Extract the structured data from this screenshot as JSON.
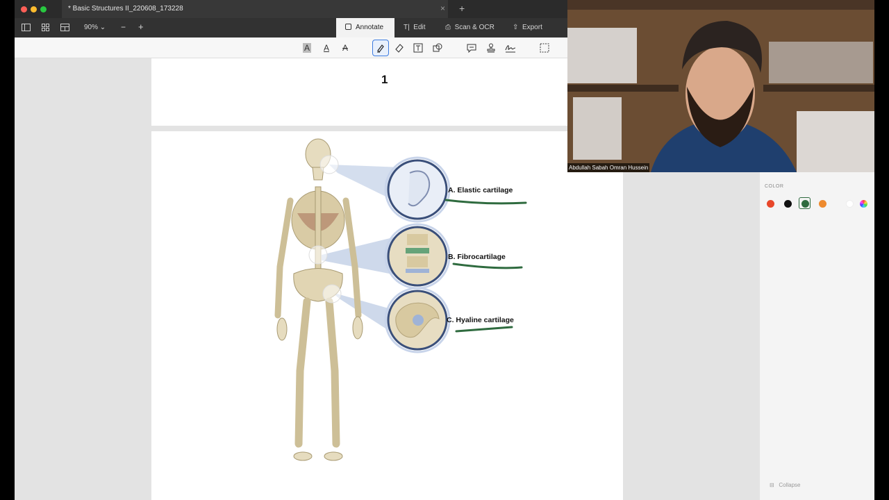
{
  "window": {
    "tab_title": "* Basic Structures II_220608_173228",
    "tab_close": "×",
    "new_tab": "+"
  },
  "toolbar": {
    "zoom": "90%",
    "zoom_out": "−",
    "zoom_in": "+",
    "tabs": [
      {
        "label": "Annotate",
        "icon": "annotate-icon"
      },
      {
        "label": "Edit",
        "icon": "edit-icon"
      },
      {
        "label": "Scan & OCR",
        "icon": "scan-icon"
      },
      {
        "label": "Export",
        "icon": "export-icon"
      }
    ]
  },
  "annotation_tools": [
    "highlight-text",
    "underline-text",
    "strikethrough-text",
    "highlighter-pen",
    "eraser",
    "text-box",
    "shapes",
    "comment",
    "stamp",
    "signature",
    "area-select"
  ],
  "document": {
    "page_number": "1",
    "figure_labels": {
      "a": "A. Elastic cartilage",
      "b": "B. Fibrocartilage",
      "c": "C. Hyaline cartilage"
    }
  },
  "sidebar": {
    "color_title": "COLOR",
    "colors": [
      "#e8472a",
      "#111111",
      "#2f6b3f",
      "#ee8a2e",
      "#ffffff"
    ],
    "selected_color": "#2f6b3f",
    "collapse_label": "Collapse"
  },
  "video": {
    "participant_name": "Abdullah Sabah Omran Hussein"
  }
}
